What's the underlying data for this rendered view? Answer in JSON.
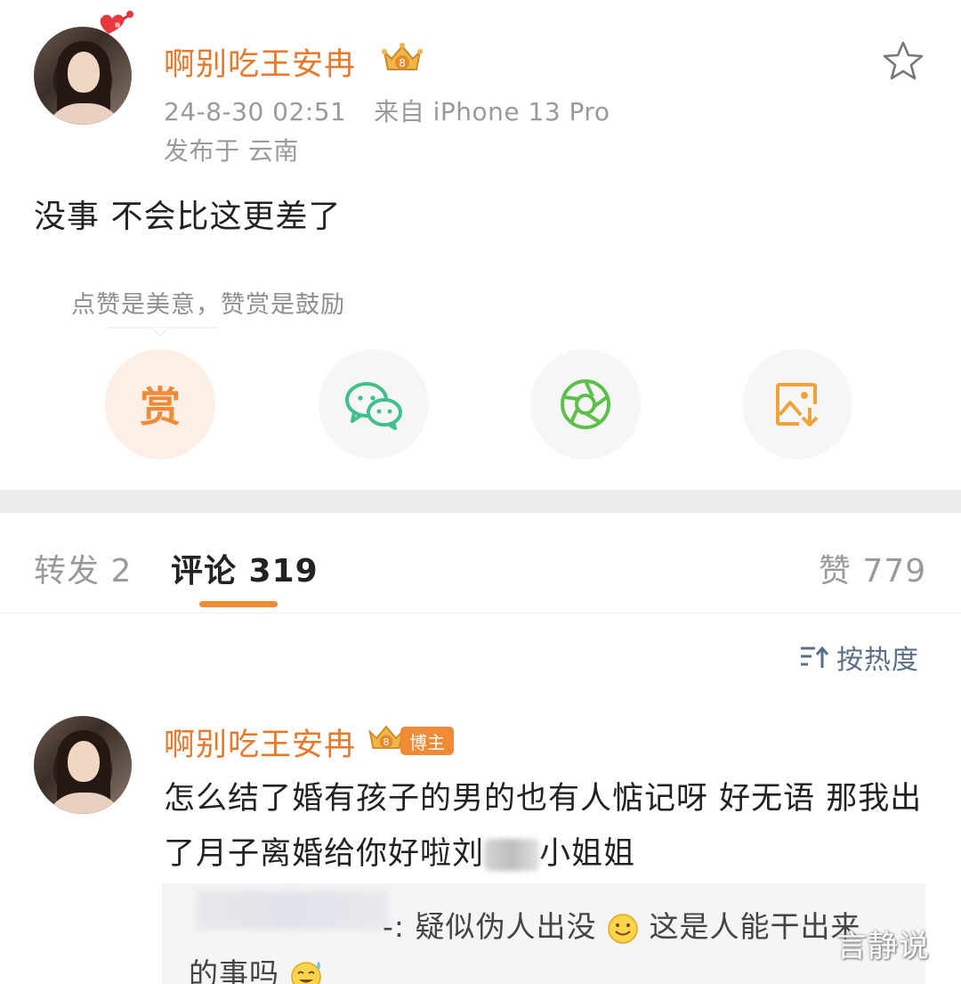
{
  "post": {
    "username": "啊别吃王安冉",
    "timestamp": "24-8-30 02:51",
    "device": "来自 iPhone 13 Pro",
    "location": "发布于 云南",
    "text": "没事 不会比这更差了",
    "reward_hint": "点赞是美意，赞赏是鼓励",
    "reward_button_label": "赏"
  },
  "share_buttons": [
    {
      "icon": "reward-icon",
      "label": "赏"
    },
    {
      "icon": "wechat-icon"
    },
    {
      "icon": "moments-icon"
    },
    {
      "icon": "save-image-icon"
    }
  ],
  "tabs": {
    "repost": "转发 2",
    "comments": "评论 319",
    "likes": "赞 779"
  },
  "sort": {
    "label": "按热度"
  },
  "comment": {
    "username": "啊别吃王安冉",
    "badge": "博主",
    "text_part1": "怎么结了婚有孩子的男的也有人惦记呀 好无语 那我出了月子离婚给你好啦刘",
    "text_part2": "小姐姐"
  },
  "reply": {
    "line1_a": "-: 疑似伪人出没",
    "line1_b": "这是人能干出来",
    "line2": "的事吗"
  },
  "watermark": "言静说",
  "colors": {
    "accent": "#e8782a",
    "orange": "#f08a37",
    "wechat_green": "#3fbf8a",
    "moments_green": "#5cbf4a",
    "meta_gray": "#9a9a9a",
    "sort_blue_gray": "#5a6f87"
  }
}
